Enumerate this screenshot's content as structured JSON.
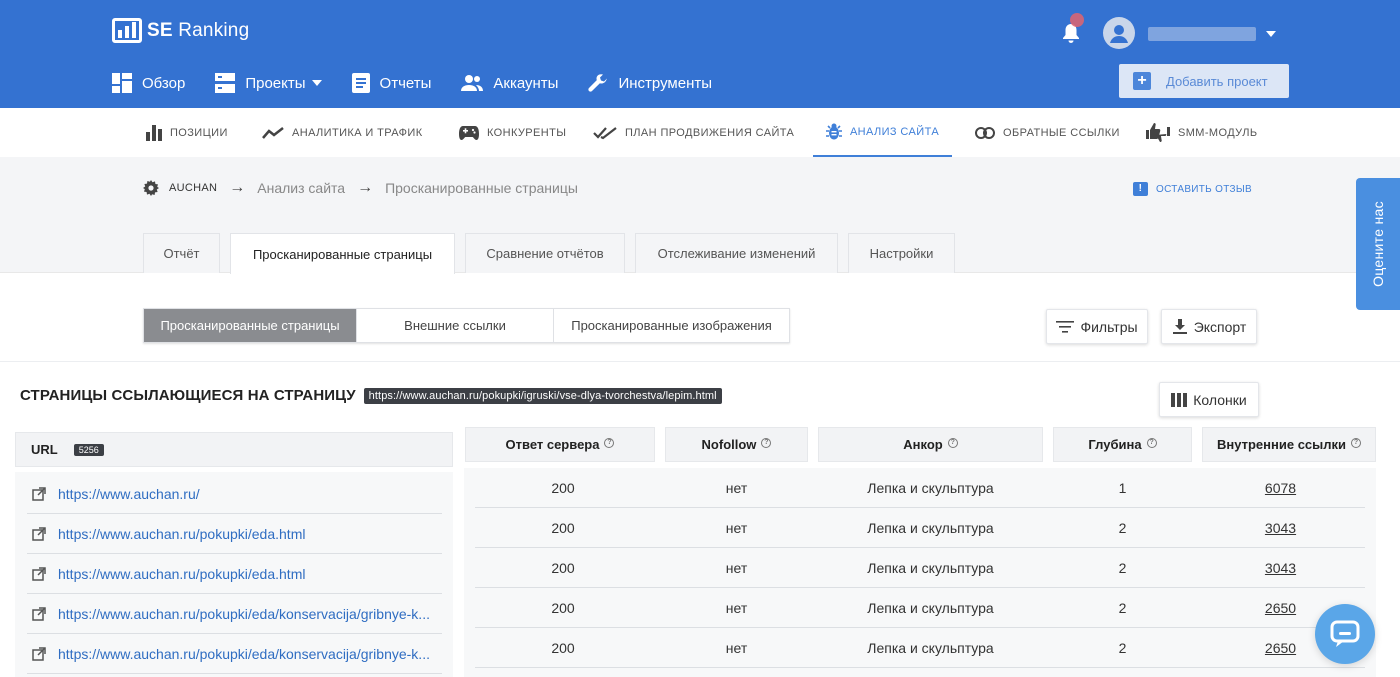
{
  "header": {
    "brand": "SE",
    "brand_suffix": "Ranking",
    "nav": [
      {
        "label": "Обзор",
        "icon": "dashboard-icon"
      },
      {
        "label": "Проекты",
        "icon": "projects-icon"
      },
      {
        "label": "Отчеты",
        "icon": "reports-icon"
      },
      {
        "label": "Аккаунты",
        "icon": "accounts-icon"
      },
      {
        "label": "Инструменты",
        "icon": "wrench-icon"
      }
    ],
    "add_project_label": "Добавить проект"
  },
  "subnav": [
    {
      "label": "Позиции",
      "icon": "bar-chart-icon"
    },
    {
      "label": "Аналитика и трафик",
      "icon": "trend-icon"
    },
    {
      "label": "Конкуренты",
      "icon": "gamepad-icon"
    },
    {
      "label": "План продвижения сайта",
      "icon": "checkmarks-icon"
    },
    {
      "label": "Анализ сайта",
      "icon": "bug-icon",
      "active": true
    },
    {
      "label": "Обратные ссылки",
      "icon": "link-icon"
    },
    {
      "label": "SMM-модуль",
      "icon": "thumbs-icon"
    }
  ],
  "breadcrumb": {
    "project": "AUCHAN",
    "items": [
      "Анализ сайта",
      "Просканированные страницы"
    ],
    "arrow": "→"
  },
  "feedback_label": "ОСТАВИТЬ ОТЗЫВ",
  "tabs": [
    {
      "label": "Отчёт"
    },
    {
      "label": "Просканированные страницы",
      "active": true
    },
    {
      "label": "Сравнение отчётов"
    },
    {
      "label": "Отслеживание изменений"
    },
    {
      "label": "Настройки"
    }
  ],
  "segments": [
    {
      "label": "Просканированные страницы",
      "active": true
    },
    {
      "label": "Внешние ссылки"
    },
    {
      "label": "Просканированные изображения"
    }
  ],
  "filters_label": "Фильтры",
  "export_label": "Экспорт",
  "columns_label": "Колонки",
  "section": {
    "title": "СТРАНИЦЫ ССЫЛАЮЩИЕСЯ НА СТРАНИЦУ",
    "url": "https://www.auchan.ru/pokupki/igruski/vse-dlya-tvorchestva/lepim.html"
  },
  "table": {
    "url_header": "URL",
    "url_count": "5256",
    "columns": [
      "Ответ сервера",
      "Nofollow",
      "Анкор",
      "Глубина",
      "Внутренние ссылки"
    ],
    "rows": [
      {
        "url": "https://www.auchan.ru/",
        "status": "200",
        "nofollow": "нет",
        "anchor": "Лепка и скульптура",
        "depth": "1",
        "internal": "6078"
      },
      {
        "url": "https://www.auchan.ru/pokupki/eda.html",
        "status": "200",
        "nofollow": "нет",
        "anchor": "Лепка и скульптура",
        "depth": "2",
        "internal": "3043"
      },
      {
        "url": "https://www.auchan.ru/pokupki/eda.html",
        "status": "200",
        "nofollow": "нет",
        "anchor": "Лепка и скульптура",
        "depth": "2",
        "internal": "3043"
      },
      {
        "url": "https://www.auchan.ru/pokupki/eda/konservacija/gribnye-k...",
        "status": "200",
        "nofollow": "нет",
        "anchor": "Лепка и скульптура",
        "depth": "2",
        "internal": "2650"
      },
      {
        "url": "https://www.auchan.ru/pokupki/eda/konservacija/gribnye-k...",
        "status": "200",
        "nofollow": "нет",
        "anchor": "Лепка и скульптура",
        "depth": "2",
        "internal": "2650"
      }
    ]
  },
  "rate_us_label": "Оцените нас",
  "help_glyph": "?",
  "colors": {
    "header": "#3472d1",
    "accent": "#3f7fd8"
  }
}
